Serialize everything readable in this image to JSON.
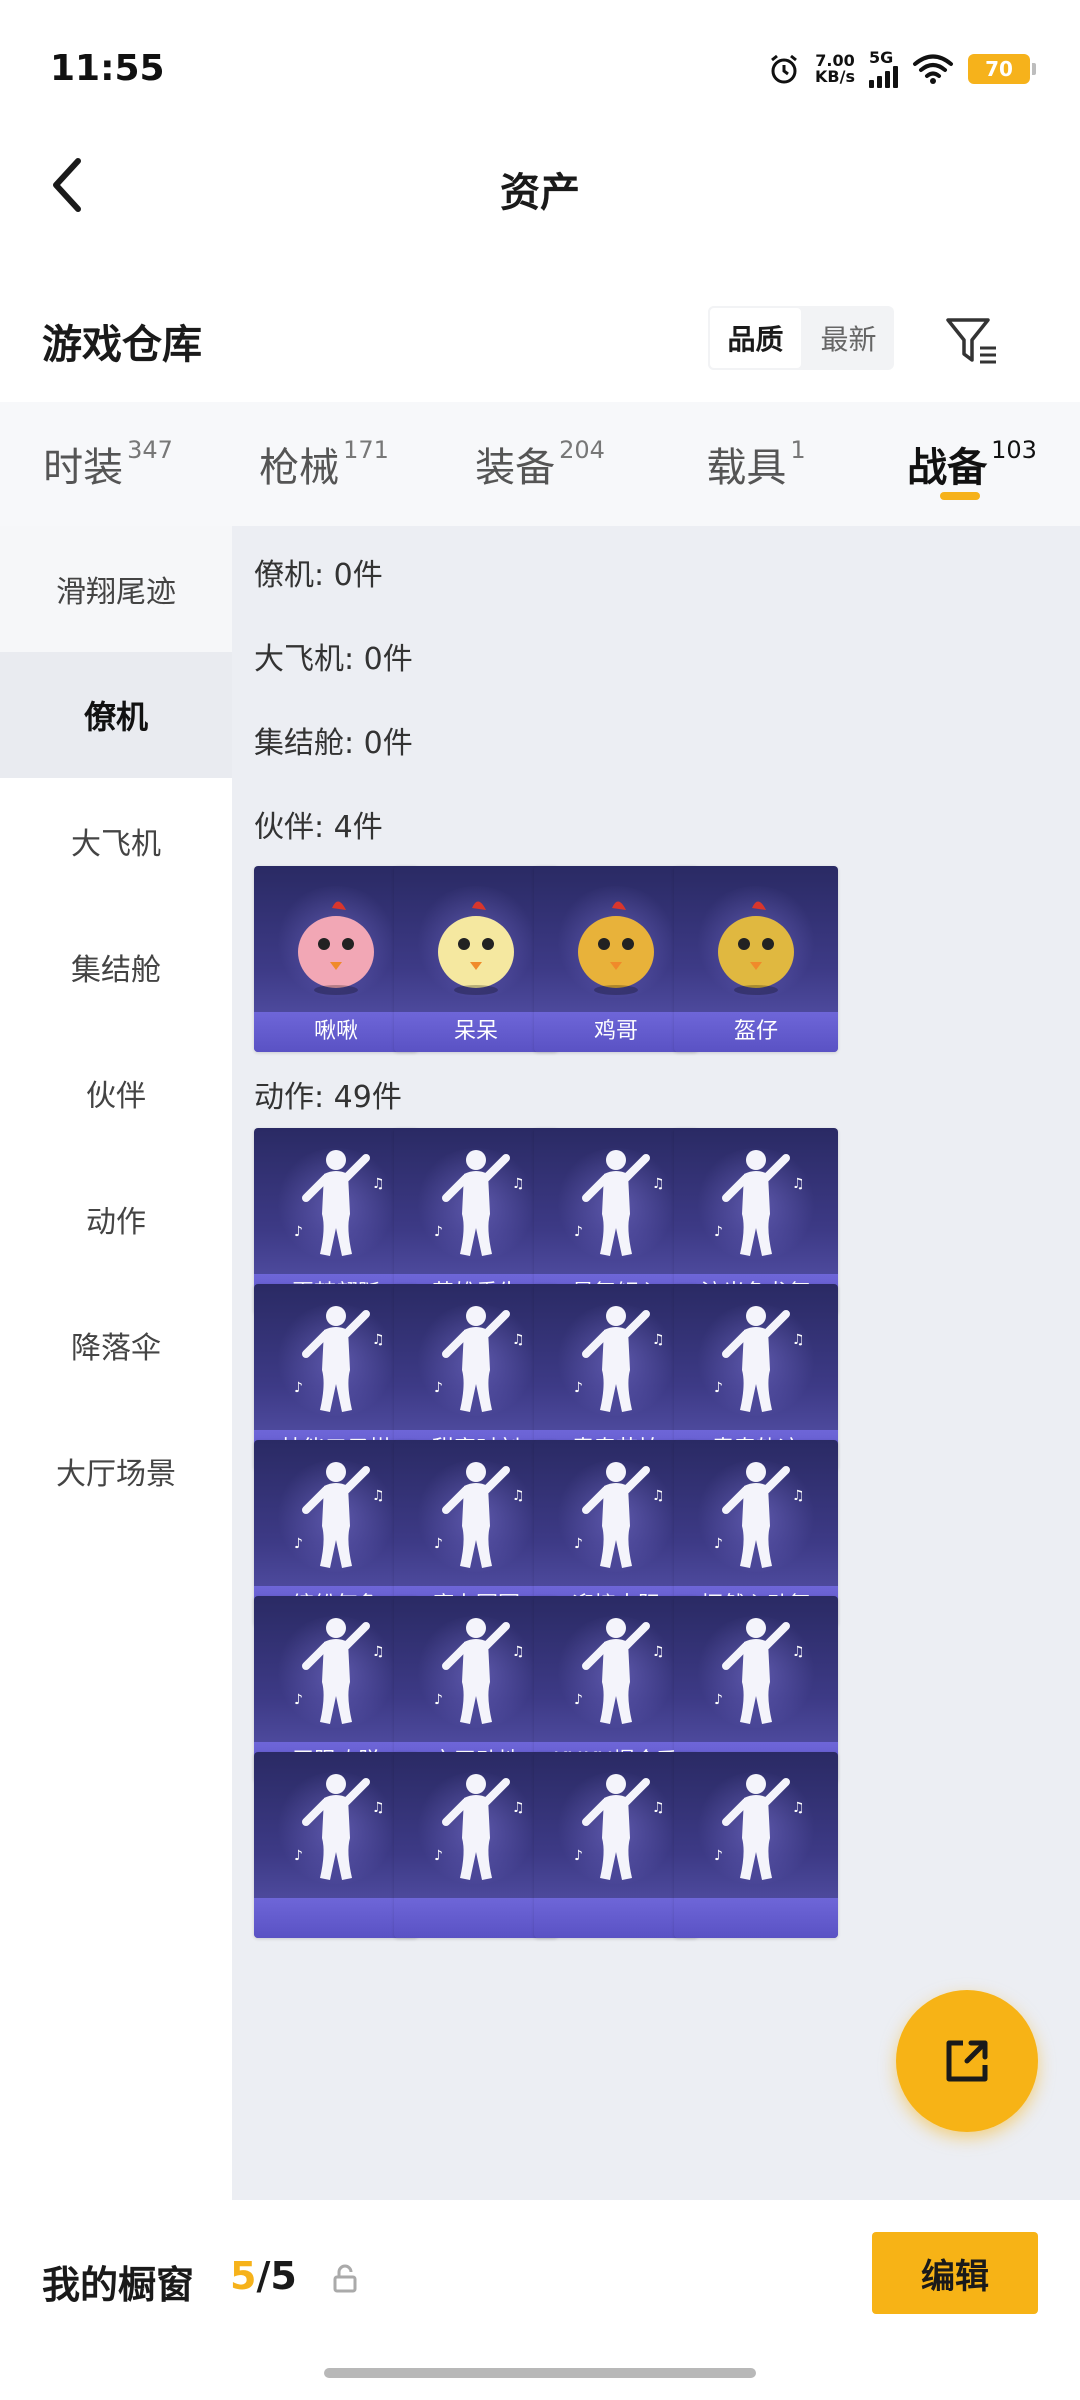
{
  "status_bar": {
    "time": "11:55",
    "net_speed_value": "7.00",
    "net_speed_unit": "KB/s",
    "network_type": "5G",
    "battery": "70"
  },
  "header": {
    "title": "资产"
  },
  "section": {
    "title": "游戏仓库",
    "sort_options": [
      "品质",
      "最新"
    ],
    "active_sort": "品质"
  },
  "category_tabs": [
    {
      "label": "时装",
      "count": "347"
    },
    {
      "label": "枪械",
      "count": "171"
    },
    {
      "label": "装备",
      "count": "204"
    },
    {
      "label": "载具",
      "count": "1"
    },
    {
      "label": "战备",
      "count": "103"
    }
  ],
  "active_category": "战备",
  "sidebar": {
    "items": [
      "滑翔尾迹",
      "僚机",
      "大飞机",
      "集结舱",
      "伙伴",
      "动作",
      "降落伞",
      "大厅场景"
    ],
    "active": "僚机"
  },
  "groups": {
    "wingman": "僚机: 0件",
    "plane": "大飞机: 0件",
    "pod": "集结舱: 0件",
    "partner": "伙伴: 4件",
    "emote": "动作: 49件"
  },
  "partners": [
    {
      "name": "啾啾",
      "color": "#f2a7b5"
    },
    {
      "name": "呆呆",
      "color": "#f5e8a0"
    },
    {
      "name": "鸡哥",
      "color": "#e8b23a"
    },
    {
      "name": "盔仔",
      "color": "#e0b840"
    }
  ],
  "emotes": [
    {
      "name": "夏梦翩跹"
    },
    {
      "name": "英雄重生"
    },
    {
      "name": "曼舞倾心"
    },
    {
      "name": "流光鱼龙舞"
    },
    {
      "name": "技能五子棋"
    },
    {
      "name": "甜蜜时刻"
    },
    {
      "name": "青春节拍"
    },
    {
      "name": "青春轨迹"
    },
    {
      "name": "缤纷气象"
    },
    {
      "name": "魔力圈圈"
    },
    {
      "name": "迎接太阳"
    },
    {
      "name": "怦然心动舞"
    },
    {
      "name": "无限欢脱"
    },
    {
      "name": "京天动地"
    },
    {
      "name": "KUKU爆金币"
    },
    {
      "name": ""
    },
    {
      "name": ""
    },
    {
      "name": ""
    },
    {
      "name": ""
    },
    {
      "name": ""
    }
  ],
  "bottom_bar": {
    "label": "我的橱窗",
    "current": "5",
    "separator": "/",
    "total": "5",
    "edit_label": "编辑"
  },
  "colors": {
    "accent": "#f7b316",
    "card_bg": "#3d3a86",
    "card_label": "#5a52c4"
  }
}
